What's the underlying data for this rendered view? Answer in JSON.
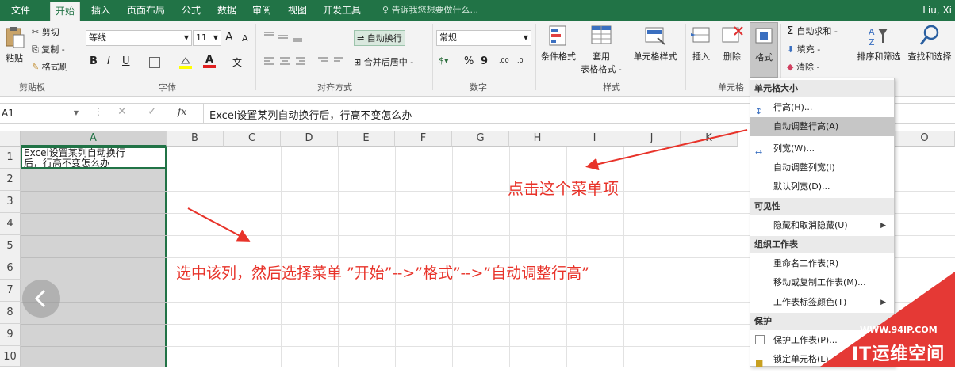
{
  "tabs": [
    {
      "label": "文件"
    },
    {
      "label": "开始"
    },
    {
      "label": "插入"
    },
    {
      "label": "页面布局"
    },
    {
      "label": "公式"
    },
    {
      "label": "数据"
    },
    {
      "label": "审阅"
    },
    {
      "label": "视图"
    },
    {
      "label": "开发工具"
    }
  ],
  "tell_me": "告诉我您想要做什么...",
  "user": "Liu, Xi",
  "clipboard": {
    "paste": "粘贴",
    "cut": "剪切",
    "copy": "复制 -",
    "format_painter": "格式刷",
    "group": "剪贴板"
  },
  "font": {
    "name": "等线",
    "size": "11",
    "grow": "A",
    "shrink": "A",
    "bold": "B",
    "italic": "I",
    "underline": "U",
    "phonetic": "文",
    "group": "字体"
  },
  "alignment": {
    "wrap": "自动换行",
    "merge": "合并后居中 -",
    "group": "对齐方式"
  },
  "number": {
    "format": "常规",
    "percent": "%",
    "comma": "9",
    "inc_decimal": ".00",
    "dec_decimal": ".0",
    "group": "数字"
  },
  "styles": {
    "conditional": "条件格式",
    "table": "套用",
    "table2": "表格格式 -",
    "cell_styles": "单元格样式",
    "group": "样式"
  },
  "cells": {
    "insert": "插入",
    "delete": "删除",
    "format": "格式",
    "group": "单元格"
  },
  "editing": {
    "autosum": "自动求和 -",
    "fill": "填充 -",
    "clear": "清除 -",
    "sort": "排序和筛选",
    "find": "查找和选择"
  },
  "formula_bar": {
    "name_box": "A1",
    "fx": "fx",
    "content": "Excel设置某列自动换行后，行高不变怎么办"
  },
  "grid": {
    "columns": [
      "A",
      "B",
      "C",
      "D",
      "E",
      "F",
      "G",
      "H",
      "I",
      "J",
      "K",
      "L",
      "O"
    ],
    "rows": [
      "1",
      "2",
      "3",
      "4",
      "5",
      "6",
      "7",
      "8",
      "9",
      "10"
    ],
    "a1_line1": "Excel设置某列自动换行",
    "a1_line2": "后，行高不变怎么办"
  },
  "menu": {
    "sections": [
      {
        "title": "单元格大小"
      },
      {
        "title": "可见性"
      },
      {
        "title": "组织工作表"
      },
      {
        "title": "保护"
      }
    ],
    "items": [
      {
        "label": "行高(H)..."
      },
      {
        "label": "自动调整行高(A)"
      },
      {
        "label": "列宽(W)..."
      },
      {
        "label": "自动调整列宽(I)"
      },
      {
        "label": "默认列宽(D)..."
      },
      {
        "label": "隐藏和取消隐藏(U)"
      },
      {
        "label": "重命名工作表(R)"
      },
      {
        "label": "移动或复制工作表(M)..."
      },
      {
        "label": "工作表标签颜色(T)"
      },
      {
        "label": "保护工作表(P)..."
      },
      {
        "label": "锁定单元格(L)"
      }
    ]
  },
  "annotations": {
    "click_hint": "点击这个菜单项",
    "instruction": "选中该列，然后选择菜单 ”开始”-->”格式”-->”自动调整行高”"
  },
  "watermark": {
    "url": "WWW.94IP.COM",
    "name": "IT运维空间"
  },
  "colors": {
    "excel_green": "#217346",
    "annotation_red": "#e8332a",
    "watermark_red": "#e53935"
  }
}
